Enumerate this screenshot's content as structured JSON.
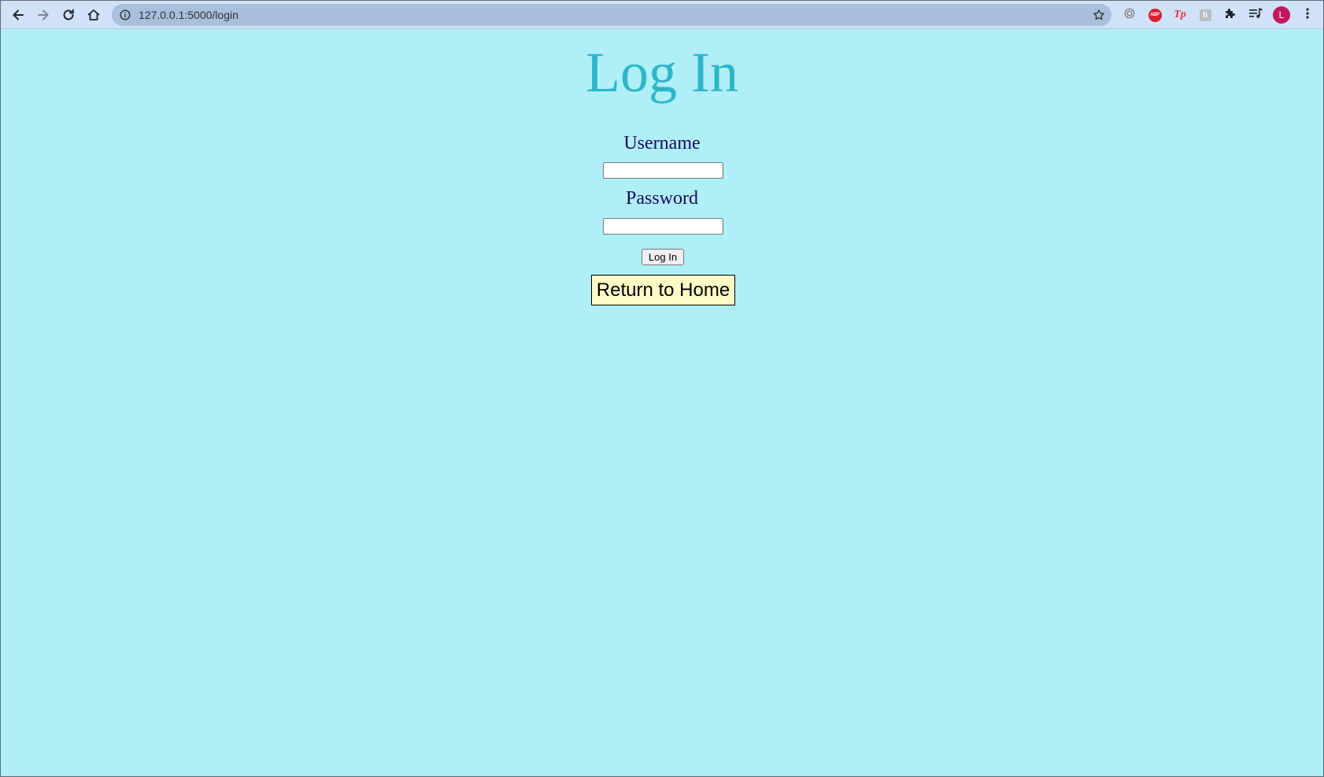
{
  "browser": {
    "url": "127.0.0.1:5000/login",
    "profile_initial": "L",
    "extensions": {
      "abp_label": "ABP",
      "tp_label": "Tp",
      "gray_ext_label": "fi"
    },
    "icons": [
      "back-icon",
      "forward-icon",
      "reload-icon",
      "home-icon",
      "info-icon",
      "star-icon",
      "gear-extension-icon",
      "puzzle-icon",
      "media-queue-icon",
      "kebab-menu-icon"
    ]
  },
  "page": {
    "title": "Log In",
    "username_label": "Username",
    "username_value": "",
    "password_label": "Password",
    "password_value": "",
    "submit_label": "Log In",
    "home_label": "Return to Home"
  },
  "colors": {
    "page_background": "#afeff8",
    "title": "#2db6c9",
    "labels": "#140a5c",
    "home_button_background": "#fffbc6",
    "toolbar": "#cfe2f7",
    "omnibox": "#a9bfdd",
    "avatar": "#c2185b"
  }
}
